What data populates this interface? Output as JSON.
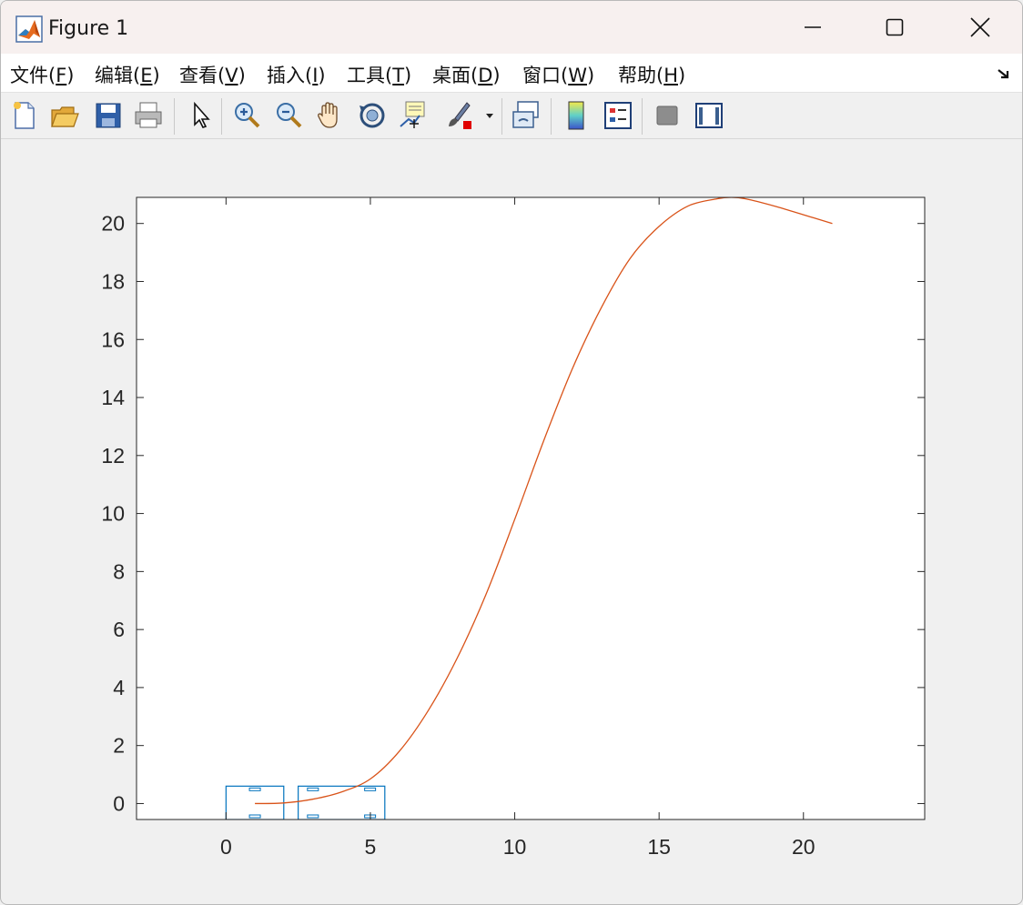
{
  "window": {
    "title": "Figure 1"
  },
  "menu": [
    {
      "label": "文件(",
      "key": "F",
      "end": ")"
    },
    {
      "label": "编辑(",
      "key": "E",
      "end": ")"
    },
    {
      "label": "查看(",
      "key": "V",
      "end": ")"
    },
    {
      "label": "插入(",
      "key": "I",
      "end": ")"
    },
    {
      "label": "工具(",
      "key": "T",
      "end": ")"
    },
    {
      "label": "桌面(",
      "key": "D",
      "end": ")"
    },
    {
      "label": "窗口(",
      "key": "W",
      "end": ")"
    },
    {
      "label": "帮助(",
      "key": "H",
      "end": ")"
    }
  ],
  "toolbar": [
    "new-figure-icon",
    "open-file-icon",
    "save-icon",
    "print-icon",
    "select-arrow-icon",
    "zoom-in-icon",
    "zoom-out-icon",
    "pan-hand-icon",
    "rotate-3d-icon",
    "data-cursor-icon",
    "brush-icon",
    "link-plot-icon",
    "colorbar-icon",
    "legend-icon",
    "hide-plot-tools-icon",
    "show-plot-tools-icon"
  ],
  "colors": {
    "curve": "#d95319",
    "rects": "#0072bd",
    "axes": "#262626"
  },
  "chart_data": {
    "type": "line",
    "xlim": [
      -3.1,
      24.2
    ],
    "ylim": [
      -0.55,
      20.9
    ],
    "xticks": [
      0,
      5,
      10,
      15,
      20
    ],
    "yticks": [
      0,
      2,
      4,
      6,
      8,
      10,
      12,
      14,
      16,
      18,
      20
    ],
    "grid": false,
    "series": [
      {
        "x": [
          1,
          2,
          3,
          4,
          5,
          6,
          7,
          8,
          9,
          10,
          11,
          12,
          13,
          14,
          15,
          16,
          17,
          17.5,
          18,
          19,
          20,
          21
        ],
        "y": [
          0,
          0.02,
          0.15,
          0.4,
          0.85,
          1.8,
          3.2,
          5.0,
          7.2,
          9.8,
          12.5,
          15.0,
          17.1,
          18.8,
          19.9,
          20.6,
          20.85,
          20.9,
          20.85,
          20.6,
          20.3,
          20.0
        ]
      }
    ],
    "rectangles": [
      {
        "x0": 0,
        "x1": 2,
        "y0": -0.55,
        "y1": 0.6
      },
      {
        "x0": 2.5,
        "x1": 5.5,
        "y0": -0.55,
        "y1": 0.6
      }
    ]
  }
}
